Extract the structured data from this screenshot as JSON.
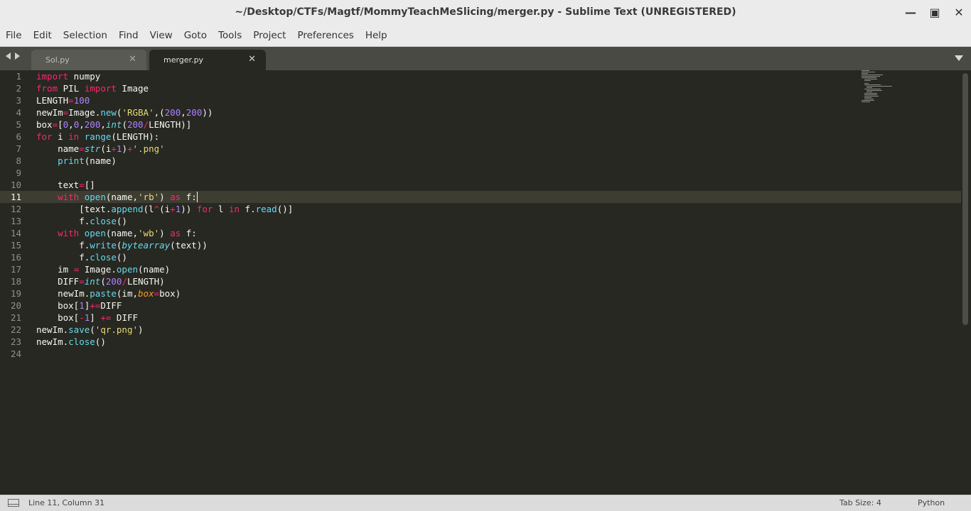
{
  "window": {
    "title": "~/Desktop/CTFs/Magtf/MommyTeachMeSlicing/merger.py - Sublime Text (UNREGISTERED)"
  },
  "menu": [
    "File",
    "Edit",
    "Selection",
    "Find",
    "View",
    "Goto",
    "Tools",
    "Project",
    "Preferences",
    "Help"
  ],
  "tabs": [
    {
      "label": "Sol.py",
      "active": false
    },
    {
      "label": "merger.py",
      "active": true
    }
  ],
  "editor": {
    "current_line": 11,
    "lines": [
      "import numpy",
      "from PIL import Image",
      "LENGTH=100",
      "newIm=Image.new('RGBA',(200,200))",
      "box=[0,0,200,int(200/LENGTH)]",
      "for i in range(LENGTH):",
      "    name=str(i+1)+'.png'",
      "    print(name)",
      "",
      "    text=[]",
      "    with open(name,'rb') as f:",
      "        [text.append(l^(i+1)) for l in f.read()]",
      "        f.close()",
      "    with open(name,'wb') as f:",
      "        f.write(bytearray(text))",
      "        f.close()",
      "    im = Image.open(name)",
      "    DIFF=int(200/LENGTH)",
      "    newIm.paste(im,box=box)",
      "    box[1]+=DIFF",
      "    box[-1] += DIFF",
      "newIm.save('qr.png')",
      "newIm.close()",
      ""
    ]
  },
  "statusbar": {
    "position": "Line 11, Column 31",
    "tab_size": "Tab Size: 4",
    "syntax": "Python"
  },
  "colors": {
    "editor_bg": "#272822",
    "keyword": "#f92672",
    "builtin": "#66d9ef",
    "number": "#ae81ff",
    "string": "#e6db74",
    "param": "#fd971f"
  }
}
